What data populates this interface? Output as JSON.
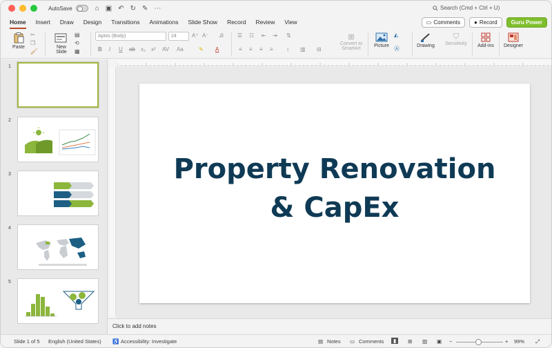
{
  "titlebar": {
    "autosave_label": "AutoSave",
    "search_placeholder": "Search (Cmd + Ctrl + U)"
  },
  "tabs": [
    "Home",
    "Insert",
    "Draw",
    "Design",
    "Transitions",
    "Animations",
    "Slide Show",
    "Record",
    "Review",
    "View"
  ],
  "active_tab": "Home",
  "tab_buttons": {
    "comments": "Comments",
    "record": "Record",
    "guru": "Guru Power"
  },
  "ribbon": {
    "paste": "Paste",
    "new_slide_1": "New",
    "new_slide_2": "Slide",
    "font_name": "Aptos (Body)",
    "font_size": "24",
    "convert_1": "Convert to",
    "convert_2": "SmartArt",
    "picture": "Picture",
    "drawing": "Drawing",
    "sensitivity": "Sensitivity",
    "addins": "Add-ins",
    "designer": "Designer"
  },
  "slides": [
    {
      "num": "1"
    },
    {
      "num": "2"
    },
    {
      "num": "3"
    },
    {
      "num": "4"
    },
    {
      "num": "5"
    }
  ],
  "slide": {
    "title_line1": "Property Renovation",
    "title_line2": "& CapEx"
  },
  "notes_placeholder": "Click to add notes",
  "status": {
    "slide_count": "Slide 1 of 5",
    "language": "English (United States)",
    "accessibility": "Accessibility: Investigate",
    "notes": "Notes",
    "comments": "Comments",
    "zoom": "99%"
  },
  "colors": {
    "accent_tab": "#b7472a",
    "title_text": "#0f3a55",
    "guru_button": "#7fbe2d",
    "thumb_green": "#8cb63c",
    "thumb_blue": "#1d5f84"
  }
}
